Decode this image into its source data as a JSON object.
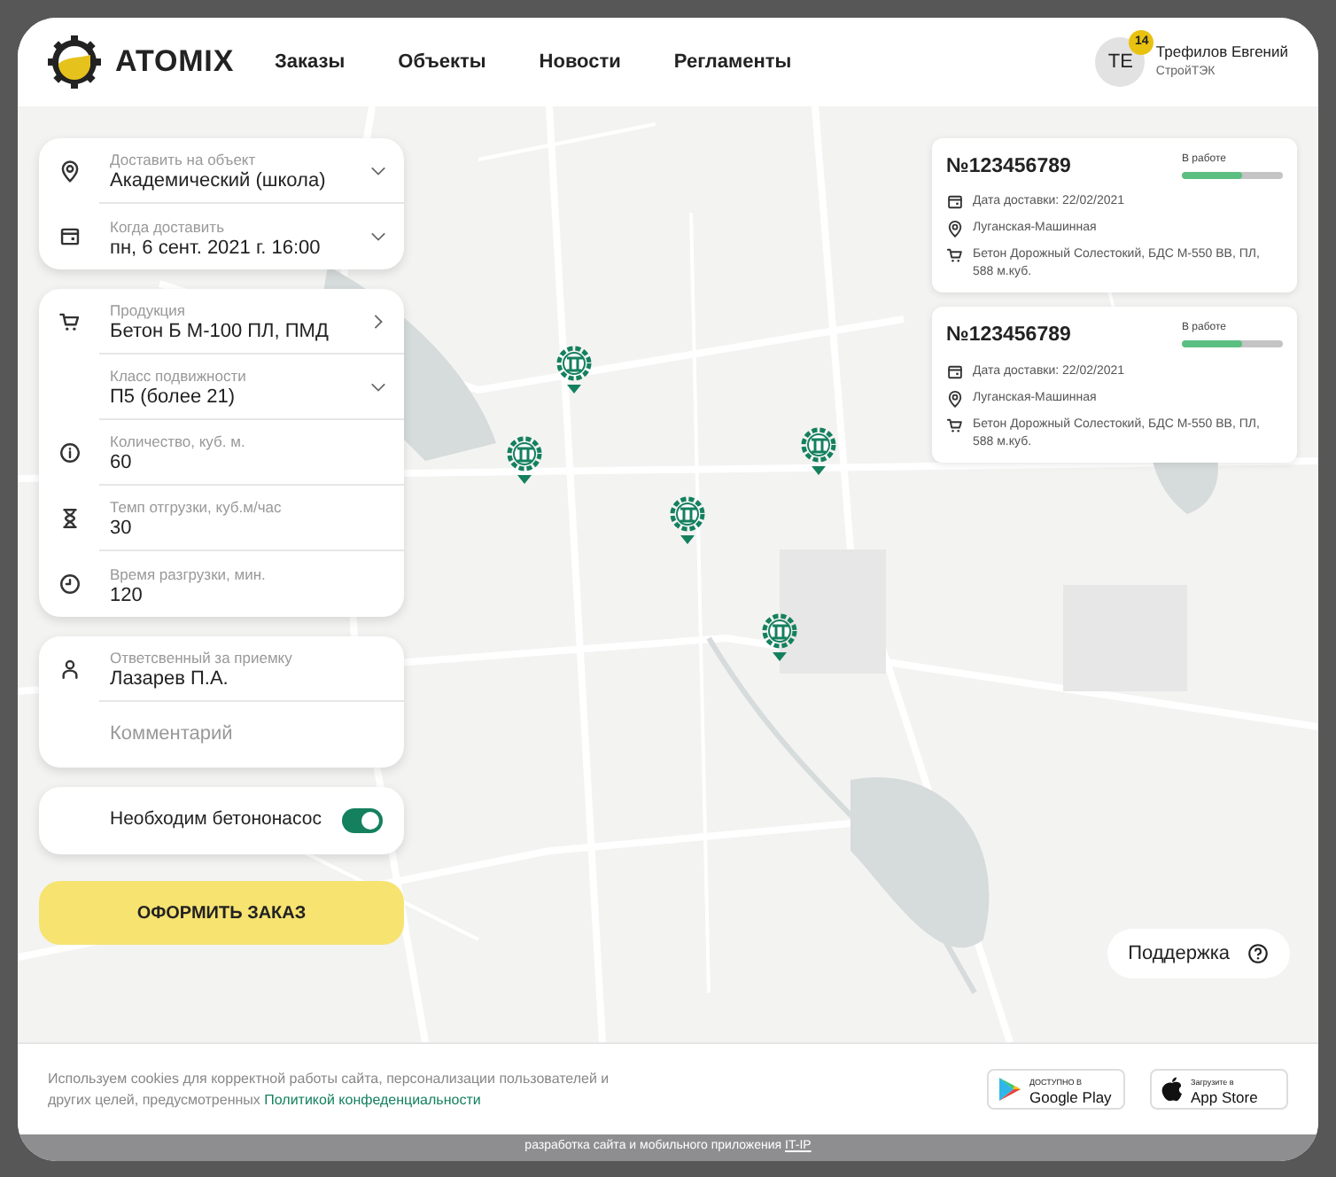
{
  "header": {
    "logo_text": "ATOMIX",
    "nav": [
      {
        "label": "Заказы"
      },
      {
        "label": "Объекты"
      },
      {
        "label": "Новости"
      },
      {
        "label": "Регламенты"
      }
    ],
    "user": {
      "initials": "ТЕ",
      "badge": "14",
      "name": "Трефилов Евгений",
      "company": "СтройТЭК"
    }
  },
  "panels": [
    {
      "fields": [
        {
          "label": "Доставить на объект",
          "value": "Академический (школа)",
          "kind": "dropdown"
        },
        {
          "label": "Когда доставить",
          "value": "пн, 6 сент. 2021 г. 16:00",
          "kind": "dropdown"
        }
      ]
    },
    {
      "fields": [
        {
          "label": "Продукция",
          "value": "Бетон Б М-100 ПЛ, ПМД",
          "kind": "link"
        },
        {
          "label": "Класс подвижности",
          "value": "П5 (более 21)",
          "kind": "dropdown"
        },
        {
          "label": "Количество, куб. м.",
          "value": "60",
          "kind": "input"
        },
        {
          "label": "Темп отгрузки, куб.м/час",
          "value": "30",
          "kind": "input"
        },
        {
          "label": "Время разгрузки, мин.",
          "value": "120",
          "kind": "input"
        }
      ]
    },
    {
      "fields": [
        {
          "label": "Ответсвенный за приемку",
          "value": "Лазарев П.А.",
          "kind": "input"
        },
        {
          "placeholder": "Комментарий",
          "kind": "textinput"
        }
      ]
    }
  ],
  "pump_toggle": {
    "label": "Необходим бетононасос",
    "on": true
  },
  "submit_button": "ОФОРМИТЬ ЗАКАЗ",
  "orders": [
    {
      "number": "№123456789",
      "status": "В работе",
      "level": 0.6,
      "date": "Дата доставки: 22/02/2021",
      "address": "Луганская-Машинная",
      "product": "Бетон Дорожный Солестокий, БДС М-550 ВВ, ПЛ, 588 м.куб."
    },
    {
      "number": "№123456789",
      "status": "В работе",
      "level": 0.6,
      "date": "Дата доставки: 22/02/2021",
      "address": "Луганская-Машинная",
      "product": "Бетон Дорожный Солестокий, БДС М-550 ВВ, ПЛ, 588 м.куб."
    }
  ],
  "support_button": "Поддержка",
  "cookie_notice": {
    "text": "Используем cookies для корректной работы сайта, персонализации пользователей и других целей, предусмотренных",
    "link": "Политикой конфеденциальности"
  },
  "store_badges": [
    {
      "kind": "google",
      "caption": "ДОСТУПНО В",
      "name": "Google Play"
    },
    {
      "kind": "apple",
      "caption": "Загрузите в",
      "name": "App Store"
    }
  ],
  "credits": {
    "text": "разработка сайта и мобильного приложения",
    "link": "IT-IP"
  }
}
